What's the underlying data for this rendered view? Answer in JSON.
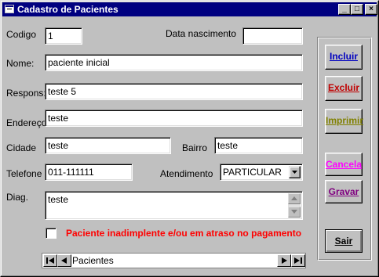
{
  "window": {
    "title": "Cadastro de Pacientes",
    "controls": {
      "minimize": "_",
      "maximize": "□",
      "close": "×"
    }
  },
  "form": {
    "codigo": {
      "label": "Codigo",
      "value": "1"
    },
    "data_nascimento": {
      "label": "Data nascimento",
      "value": ""
    },
    "nome": {
      "label": "Nome:",
      "value": "paciente inicial"
    },
    "respons": {
      "label": "Respons:",
      "value": "teste 5"
    },
    "endereco": {
      "label": "Endereço",
      "value": "teste"
    },
    "cidade": {
      "label": "Cidade",
      "value": "teste"
    },
    "bairro": {
      "label": "Bairro",
      "value": "teste"
    },
    "telefone": {
      "label": "Telefone",
      "value": "011-111111"
    },
    "atendimento": {
      "label": "Atendimento",
      "value": "PARTICULAR"
    },
    "diag": {
      "label": "Diag.",
      "value": "teste"
    },
    "inadimplente": {
      "label": "Paciente inadimplente e/ou em atraso no pagamento",
      "checked": false
    }
  },
  "buttons": {
    "incluir": {
      "label": "Incluir",
      "color": "#0000c0"
    },
    "excluir": {
      "label": "Excluir",
      "color": "#c00000"
    },
    "imprimir": {
      "label": "Imprimir",
      "color": "#808000"
    },
    "cancela": {
      "label": "Cancela",
      "color": "#ff00ff"
    },
    "gravar": {
      "label": "Gravar",
      "color": "#800080"
    },
    "sair": {
      "label": "Sair",
      "color": "#000000"
    }
  },
  "navigator": {
    "caption": "Pacientes"
  },
  "icons": [
    "app-icon",
    "minimize-icon",
    "maximize-icon",
    "close-icon",
    "dropdown-arrow-icon",
    "scroll-up-icon",
    "scroll-down-icon",
    "first-record-icon",
    "prev-record-icon",
    "next-record-icon",
    "last-record-icon"
  ]
}
